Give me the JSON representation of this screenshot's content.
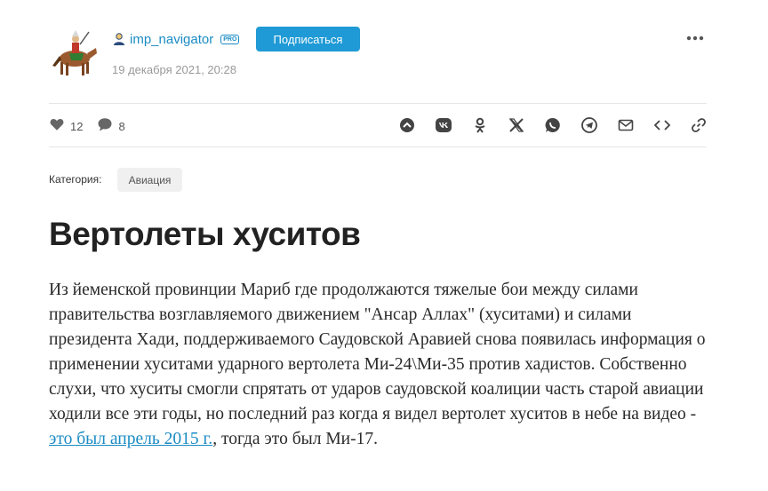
{
  "author": {
    "name": "imp_navigator",
    "badge": "PRO",
    "date": "19 декабря 2021, 20:28"
  },
  "subscribe_label": "Подписаться",
  "stats": {
    "likes": "12",
    "comments": "8"
  },
  "share_icons": [
    "share-icon",
    "vk-icon",
    "ok-icon",
    "x-icon",
    "whatsapp-icon",
    "telegram-icon",
    "mail-icon",
    "embed-icon",
    "link-icon"
  ],
  "category": {
    "label": "Категория:",
    "value": "Авиация"
  },
  "article": {
    "title": "Вертолеты хуситов",
    "paragraph_before": "Из йеменской провинции Мариб где продолжаются тяжелые бои между силами правительства возглавляемого движением \"Ансар Аллах\" (хуситами) и силами президента Хади, поддерживаемого Саудовской Аравией снова появилась информация о применении хуситами ударного вертолета Ми-24\\Ми-35 против хадистов. Собственно слухи, что хуситы смогли спрятать от ударов саудовской коалиции часть старой авиации ходили все эти годы, но последний раз когда я видел вертолет хуситов в небе на видео - ",
    "link_text": "это был апрель 2015 г.",
    "paragraph_after": ", тогда это был Ми-17."
  },
  "colors": {
    "accent": "#1f9ad6",
    "link": "#1a8bc4",
    "icon": "#444444"
  }
}
